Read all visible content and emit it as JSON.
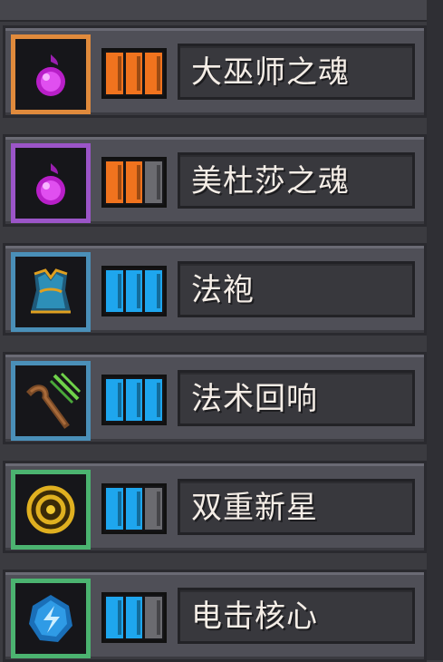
{
  "items": [
    {
      "name": "大巫师之魂",
      "icon": "purple-soul-icon",
      "frame_color": "#e08a3c",
      "level": 3,
      "max_level": 3,
      "pip_color": "#f0731e"
    },
    {
      "name": "美杜莎之魂",
      "icon": "purple-soul-icon",
      "frame_color": "#9b55c8",
      "level": 2,
      "max_level": 3,
      "pip_color": "#f0731e"
    },
    {
      "name": "法袍",
      "icon": "robe-icon",
      "frame_color": "#4a8fb8",
      "level": 3,
      "max_level": 3,
      "pip_color": "#1ea6ee"
    },
    {
      "name": "法术回响",
      "icon": "staff-icon",
      "frame_color": "#4a8fb8",
      "level": 3,
      "max_level": 3,
      "pip_color": "#1ea6ee"
    },
    {
      "name": "双重新星",
      "icon": "nova-ring-icon",
      "frame_color": "#4bb370",
      "level": 2,
      "max_level": 3,
      "pip_color": "#1ea6ee"
    },
    {
      "name": "电击核心",
      "icon": "lightning-core-icon",
      "frame_color": "#4bb370",
      "level": 2,
      "max_level": 3,
      "pip_color": "#1ea6ee"
    }
  ],
  "colors": {
    "empty_pip": "#6b6b70",
    "name_text": "#f4ede6"
  }
}
